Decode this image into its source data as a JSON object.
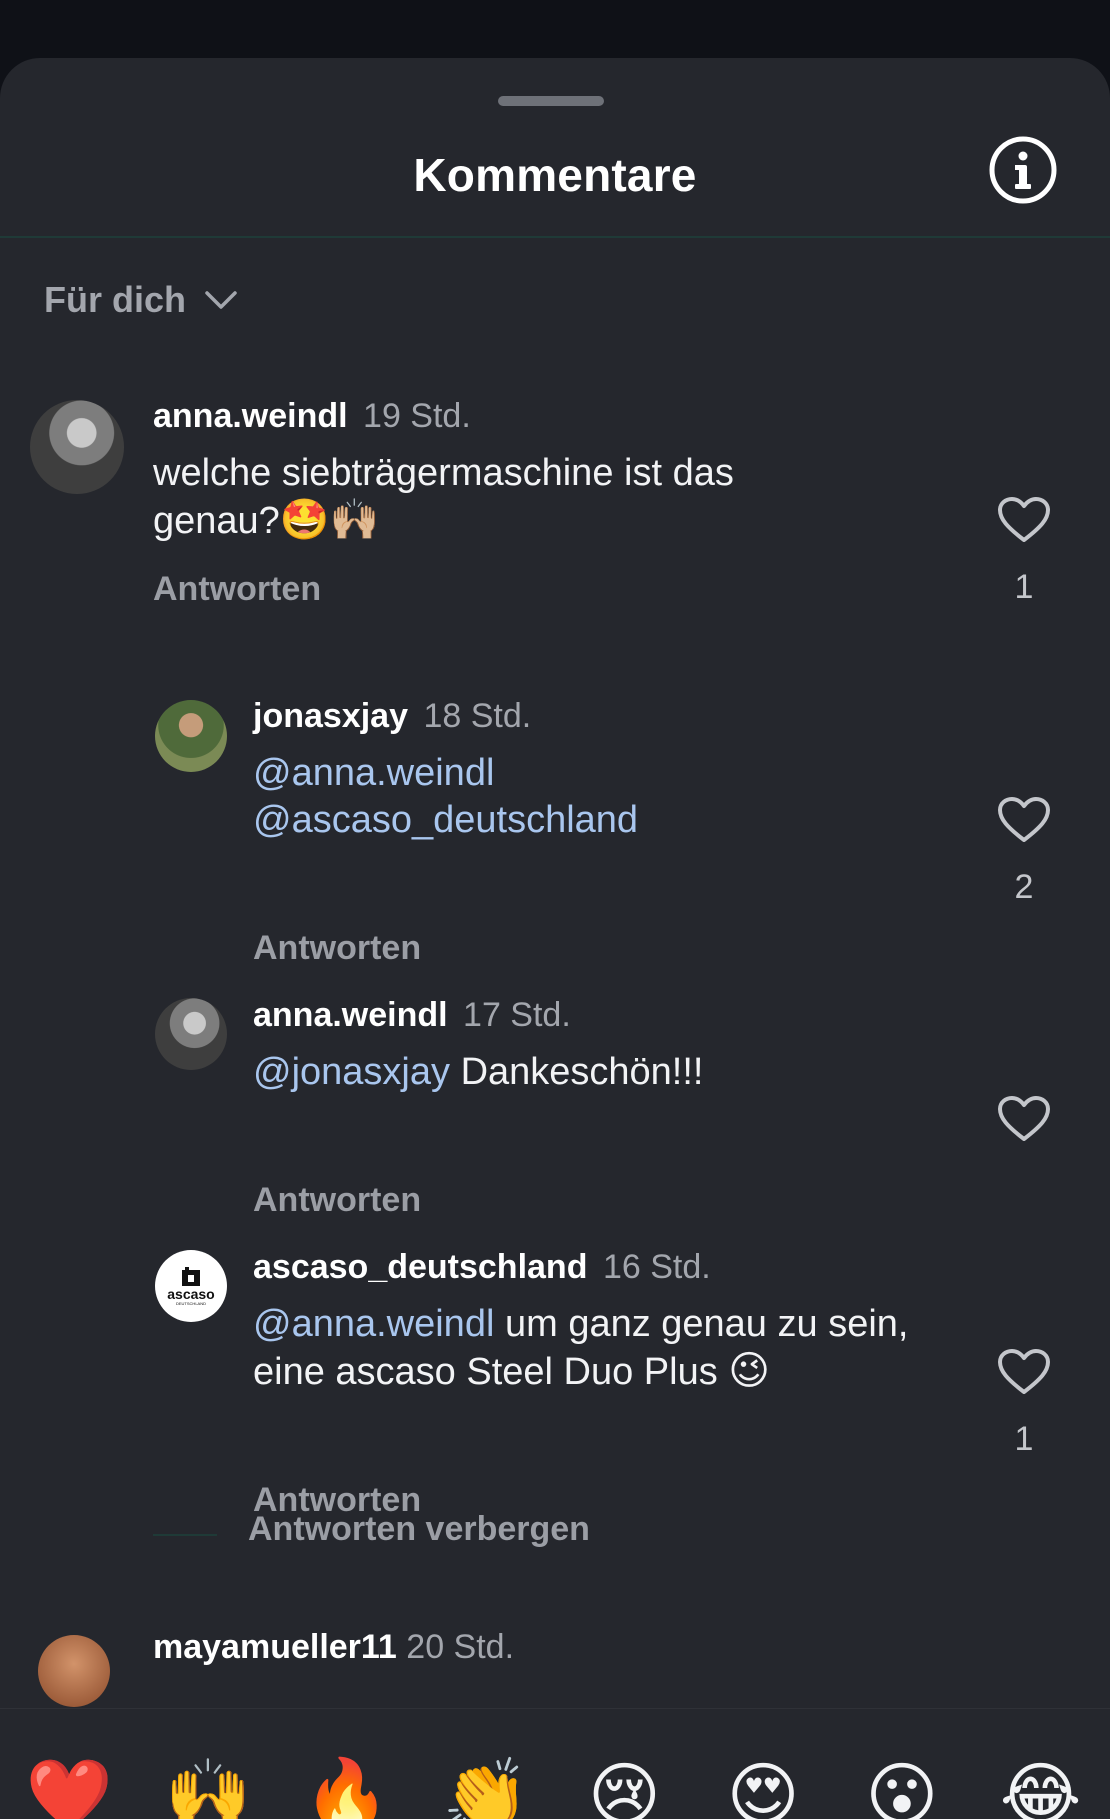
{
  "header": {
    "title": "Kommentare",
    "info_icon": "info-circle-icon"
  },
  "filter": {
    "label": "Für dich",
    "icon": "chevron-down-icon"
  },
  "comments": [
    {
      "user": "anna.weindl",
      "time": "19 Std.",
      "text_plain": "welche siebträgermaschine ist das genau?",
      "emojis": "🤩🙌🏼",
      "reply_label": "Antworten",
      "likes": "1"
    },
    {
      "user": "jonasxjay",
      "time": "18 Std.",
      "mention1": "@anna.weindl",
      "mention2": "@ascaso_deutschland",
      "reply_label": "Antworten",
      "likes": "2"
    },
    {
      "user": "anna.weindl",
      "time": "17 Std.",
      "mention": "@jonasxjay",
      "text_plain": "Dankeschön!!!",
      "reply_label": "Antworten",
      "likes": ""
    },
    {
      "user": "ascaso_deutschland",
      "time": "16 Std.",
      "mention": "@anna.weindl",
      "text_plain": "um ganz genau zu sein, eine ascaso Steel Duo Plus",
      "emoji": "😉",
      "reply_label": "Antworten",
      "likes": "1",
      "logo_text": "ascaso",
      "logo_subtext": "DEUTSCHLAND"
    }
  ],
  "hide_replies_label": "Antworten verbergen",
  "peek_comment": {
    "user": "mayamueller11",
    "time": "20 Std."
  },
  "emoji_bar": [
    "❤️",
    "🙌",
    "🔥",
    "👏",
    "😢",
    "😍",
    "😮",
    "😂"
  ],
  "colors": {
    "background": "#25272d",
    "mention": "#a9c6ee",
    "muted": "#a3a6ad"
  }
}
